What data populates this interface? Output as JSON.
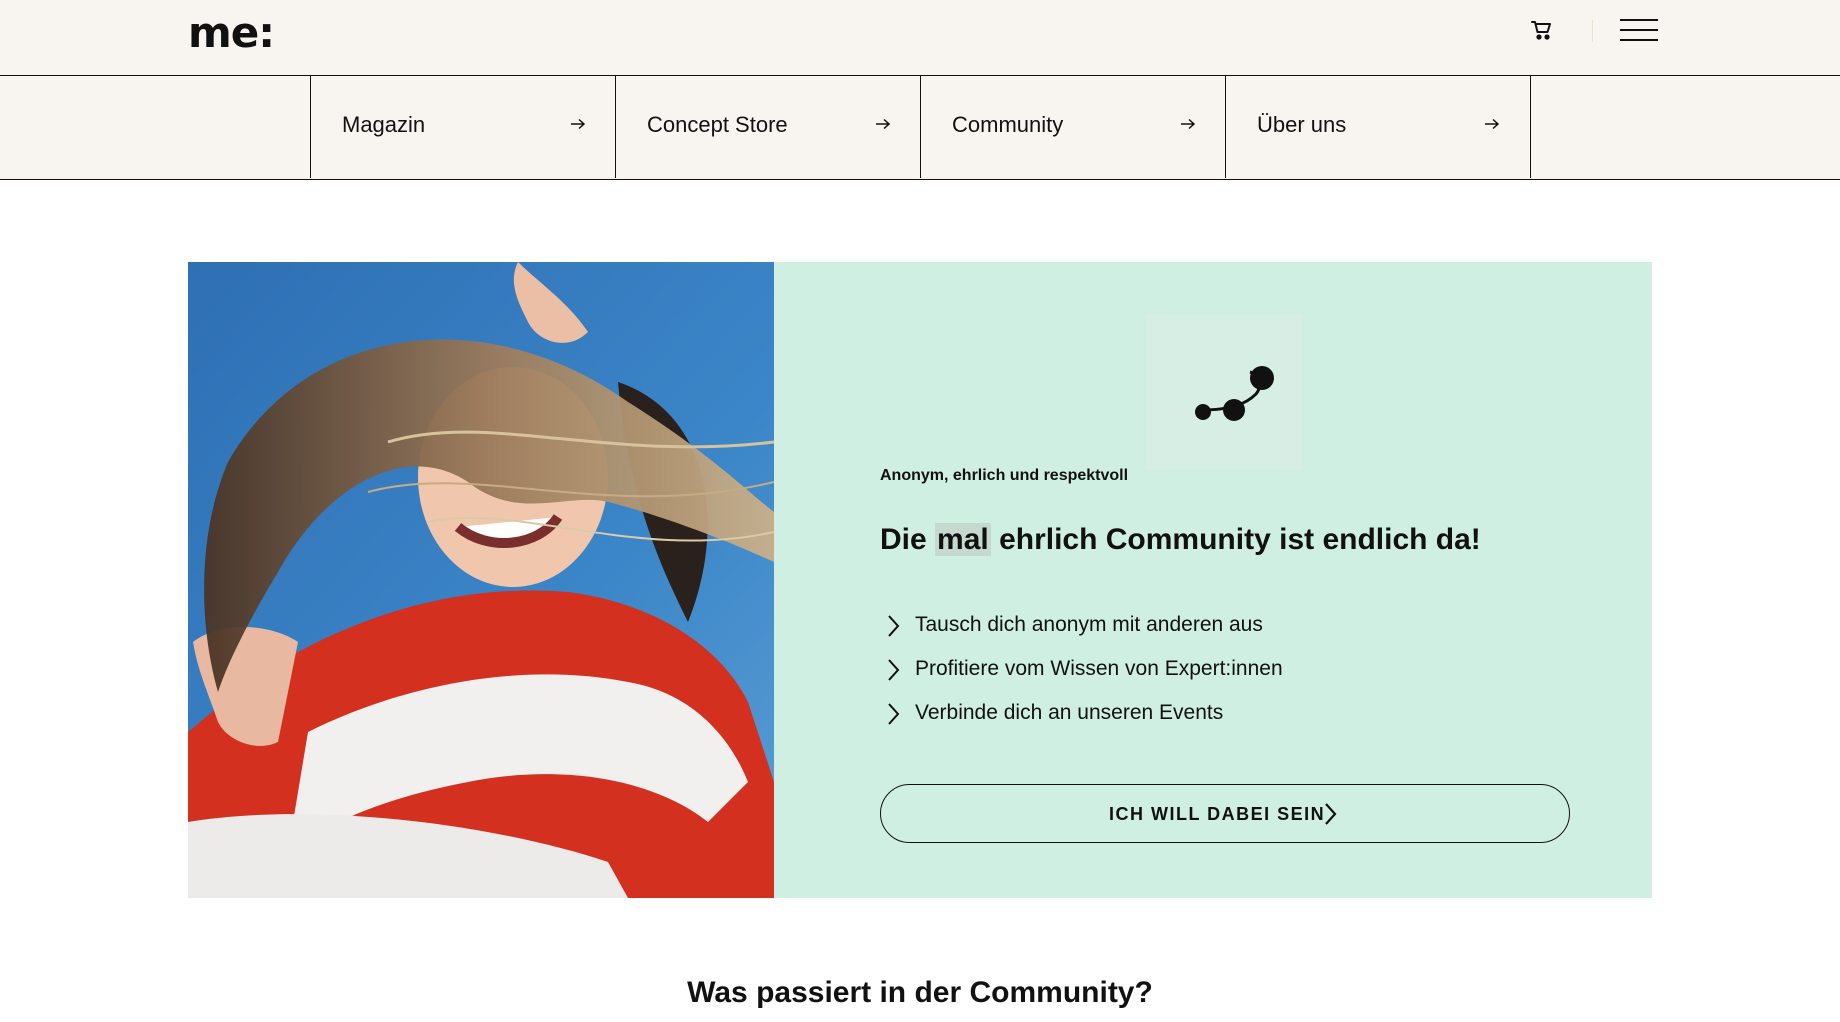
{
  "header": {
    "logo": "me:",
    "icons": {
      "cart": "cart-icon",
      "menu": "hamburger-menu-icon"
    }
  },
  "nav": {
    "items": [
      {
        "label": "Magazin",
        "icon": "arrow-right-icon"
      },
      {
        "label": "Concept Store",
        "icon": "arrow-right-icon"
      },
      {
        "label": "Community",
        "icon": "arrow-right-icon"
      },
      {
        "label": "Über uns",
        "icon": "arrow-right-icon"
      }
    ]
  },
  "hero": {
    "image_alt": "photo of two women hugging, hair blowing in wind, blue sky",
    "icon": "community-connection-icon",
    "eyebrow": "Anonym, ehrlich und respektvoll",
    "title_pre": "Die ",
    "title_highlight": "mal",
    "title_post": " ehrlich Community ist endlich da!",
    "bullets": [
      "Tausch dich anonym mit anderen aus",
      "Profitiere vom Wissen von Expert:innen",
      "Verbinde dich an unseren Events"
    ],
    "cta_label": "ICH WILL DABEI SEIN"
  },
  "section": {
    "title": "Was passiert in der Community?"
  },
  "colors": {
    "header_bg": "#f8f5f0",
    "panel_bg": "#d0efe3",
    "text": "#111111"
  }
}
